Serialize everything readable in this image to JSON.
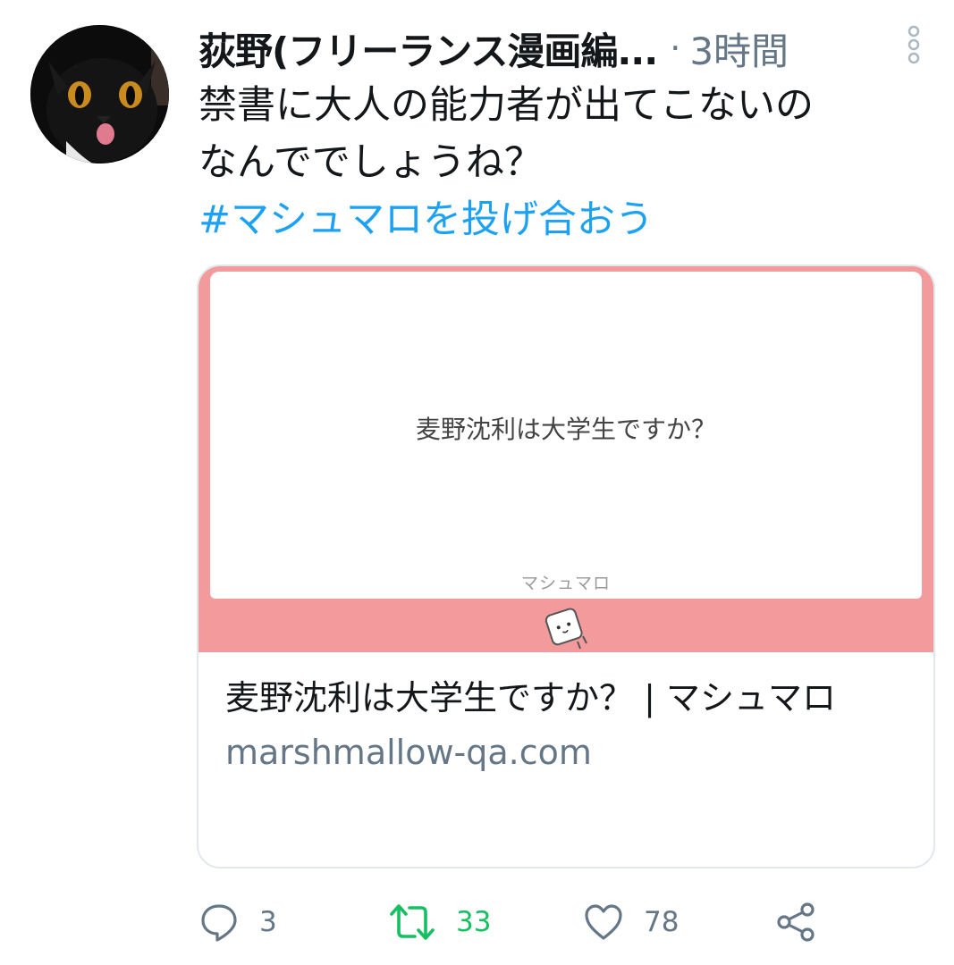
{
  "tweet": {
    "author": {
      "display_name": "荻野(フリーランス漫画編...",
      "avatar_icon": "black-cat-avatar"
    },
    "separator": "·",
    "timestamp": "3時間",
    "text_lines": [
      "禁書に大人の能力者が出てこないの",
      "なんででしょうね？"
    ],
    "hashtag": "#マシュマロを投げ合おう"
  },
  "card": {
    "image_question": "麦野沈利は大学生ですか？",
    "image_watermark": "マシュマロ",
    "title": "麦野沈利は大学生ですか？ | マシュマロ",
    "domain": "marshmallow-qa.com",
    "image_background_color": "#f29a9c"
  },
  "actions": {
    "reply": {
      "icon": "reply-icon",
      "count": "3"
    },
    "retweet": {
      "icon": "retweet-icon",
      "count": "33",
      "active_color": "#17bf63"
    },
    "like": {
      "icon": "heart-icon",
      "count": "78"
    },
    "share": {
      "icon": "share-icon"
    }
  },
  "colors": {
    "text": "#14171a",
    "secondary": "#657786",
    "link": "#1da1f2"
  }
}
